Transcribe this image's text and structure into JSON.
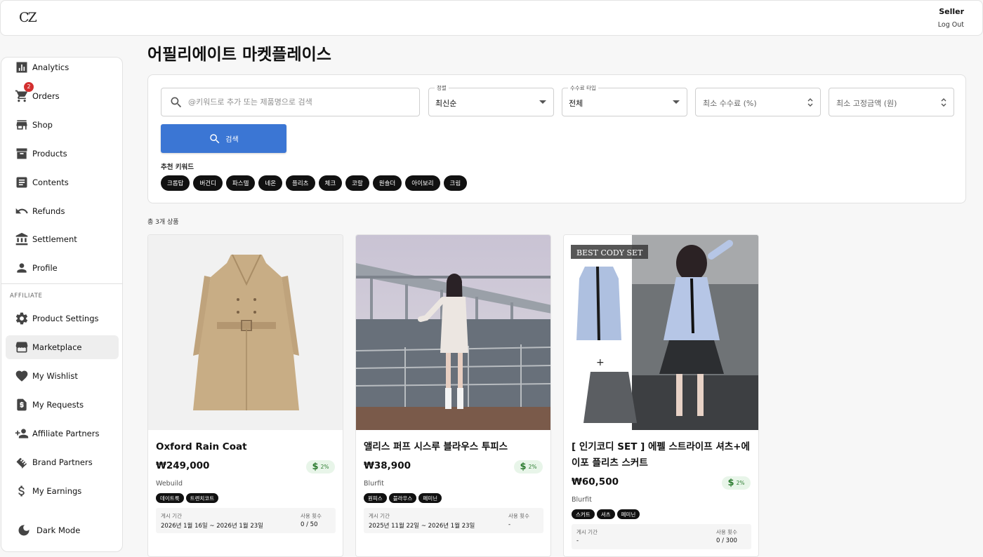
{
  "app": {
    "logo": "CZ",
    "user_role": "Seller",
    "logout_label": "Log Out"
  },
  "sidebar": {
    "items": [
      {
        "label": "Analytics",
        "icon": "analytics-icon"
      },
      {
        "label": "Orders",
        "icon": "cart-icon",
        "badge": "2"
      },
      {
        "label": "Shop",
        "icon": "store-icon"
      },
      {
        "label": "Products",
        "icon": "archive-icon"
      },
      {
        "label": "Contents",
        "icon": "article-icon"
      },
      {
        "label": "Refunds",
        "icon": "undo-icon"
      },
      {
        "label": "Settlement",
        "icon": "bank-icon"
      },
      {
        "label": "Profile",
        "icon": "person-icon"
      }
    ],
    "affiliate_section_label": "AFFILIATE",
    "affiliate_items": [
      {
        "label": "Product Settings",
        "icon": "gear-icon"
      },
      {
        "label": "Marketplace",
        "icon": "storefront-icon",
        "active": true
      },
      {
        "label": "My Wishlist",
        "icon": "heart-icon"
      },
      {
        "label": "My Requests",
        "icon": "request-doc-icon"
      },
      {
        "label": "Affiliate Partners",
        "icon": "person-add-icon"
      },
      {
        "label": "Brand Partners",
        "icon": "handshake-icon"
      },
      {
        "label": "My Earnings",
        "icon": "dollar-icon"
      }
    ],
    "dark_mode_label": "Dark Mode"
  },
  "page": {
    "title": "어필리에이트 마켓플레이스"
  },
  "filters": {
    "search_placeholder": "@키워드로 추가 또는 제품명으로 검색",
    "sort": {
      "label": "정렬",
      "value": "최신순"
    },
    "commission_type": {
      "label": "수수료 타입",
      "value": "전체"
    },
    "min_commission_placeholder": "최소 수수료 (%)",
    "min_fixed_placeholder": "최소 고정금액 (원)",
    "search_button": "검색",
    "keywords_label": "추천 키워드",
    "keywords": [
      "크롭탑",
      "버건디",
      "파스텔",
      "네온",
      "플리츠",
      "체크",
      "코랄",
      "원숄더",
      "아이보리",
      "크림"
    ]
  },
  "results": {
    "total_label": "총 3개 상품",
    "products": [
      {
        "name": "Oxford Rain Coat",
        "price": "₩249,000",
        "commission": "2%",
        "brand": "Webuild",
        "tags": [
          "데이트룩",
          "트렌치코트"
        ],
        "period_label": "게시 기간",
        "period": "2026년 1월 16일 ~ 2026년 1월 23일",
        "usage_label": "사용 횟수",
        "usage": "0 / 50"
      },
      {
        "name": "앨리스 퍼프 시스루 블라우스 투피스",
        "price": "₩38,900",
        "commission": "2%",
        "brand": "Blurfit",
        "tags": [
          "원피스",
          "블라우스",
          "페미닌"
        ],
        "period_label": "게시 기간",
        "period": "2025년 11월 22일 ~ 2026년 1월 23일",
        "usage_label": "사용 횟수",
        "usage": "-"
      },
      {
        "name": "[ 인기코디 SET ] 에펠 스트라이프 셔츠+에이포 플리츠 스커트",
        "price": "₩60,500",
        "commission": "2%",
        "brand": "Blurfit",
        "tags": [
          "스커트",
          "셔츠",
          "페미닌"
        ],
        "period_label": "게시 기간",
        "period": "-",
        "usage_label": "사용 횟수",
        "usage": "0 / 300",
        "image_caption": "BEST CODY SET"
      }
    ]
  }
}
